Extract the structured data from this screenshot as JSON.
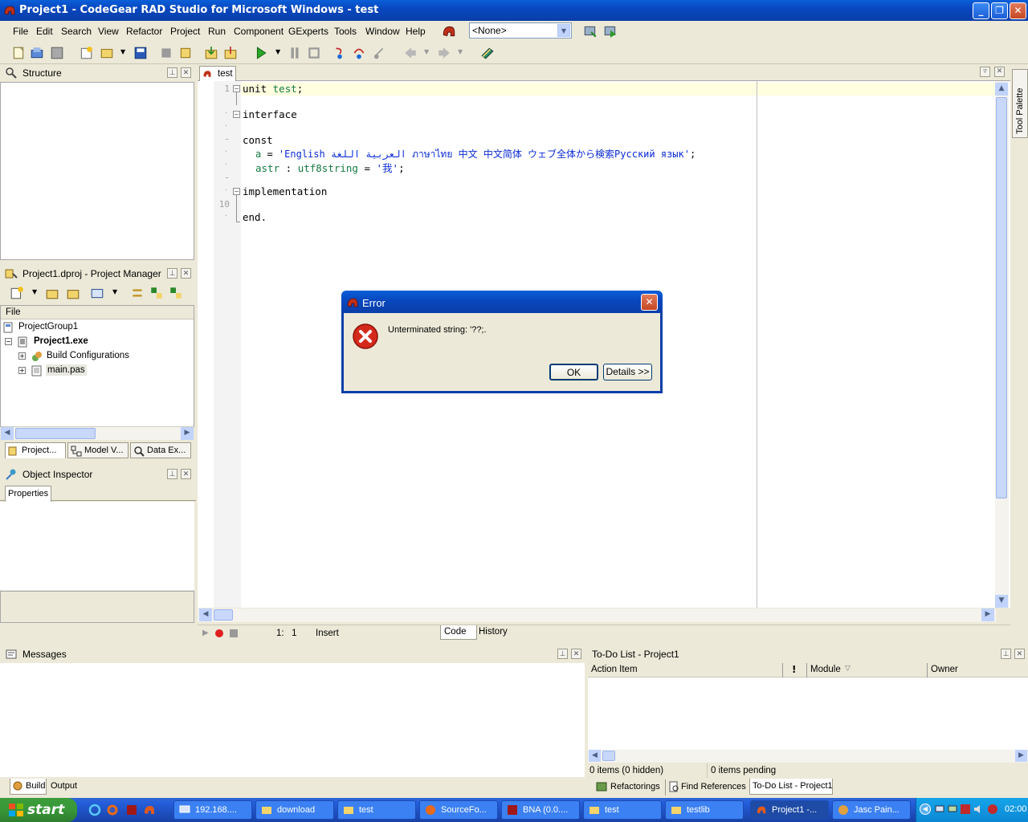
{
  "window": {
    "title": "Project1 - CodeGear RAD Studio for Microsoft Windows - test"
  },
  "menu": [
    "File",
    "Edit",
    "Search",
    "View",
    "Refactor",
    "Project",
    "Run",
    "Component",
    "GExperts",
    "Tools",
    "Window",
    "Help"
  ],
  "layout_combo": {
    "value": "<None>"
  },
  "structure": {
    "title": "Structure"
  },
  "project_manager": {
    "title": "Project1.dproj - Project Manager",
    "column": "File",
    "tree": [
      "ProjectGroup1",
      "Project1.exe",
      "Build Configurations",
      "main.pas"
    ],
    "tabs": [
      "Project...",
      "Model V...",
      "Data Ex..."
    ]
  },
  "object_inspector": {
    "title": "Object Inspector",
    "tab": "Properties"
  },
  "editor": {
    "tab": "test",
    "line_numbers": [
      "1",
      "10"
    ],
    "lines": [
      [
        "unit ",
        "test",
        ";"
      ],
      [
        "interface"
      ],
      [
        "const"
      ],
      [
        "a",
        " = ",
        "'English العربية اللغة ภาษาไทย 中文 中文简体 ウェブ全体から検索Русский язык'",
        ";"
      ],
      [
        "astr",
        " : ",
        "utf8string",
        " = ",
        "'我'",
        ";"
      ],
      [
        "implementation"
      ],
      [
        "end."
      ]
    ],
    "status": {
      "position": "1:   1",
      "mode": "Insert"
    },
    "bottom_tabs": [
      "Code",
      "History"
    ],
    "side_tab": "Tool Palette"
  },
  "dialog": {
    "title": "Error",
    "message": "Unterminated string: '??;.",
    "ok": "OK",
    "details": "Details >>"
  },
  "messages": {
    "title": "Messages",
    "tabs": [
      "Build",
      "Output"
    ]
  },
  "todo": {
    "title": "To-Do List - Project1",
    "columns": [
      "Action Item",
      "!",
      "Module",
      "Owner"
    ],
    "status_left": "0 items (0 hidden)",
    "status_right": "0 items pending",
    "tabs": [
      "Refactorings",
      "Find References",
      "To-Do List - Project1"
    ]
  },
  "taskbar": {
    "start": "start",
    "items": [
      "192.168....",
      "download",
      "test",
      "SourceFo...",
      "BNA (0.0....",
      "test",
      "testlib",
      "Project1 -...",
      "Jasc Pain..."
    ],
    "clock": "02:00"
  }
}
